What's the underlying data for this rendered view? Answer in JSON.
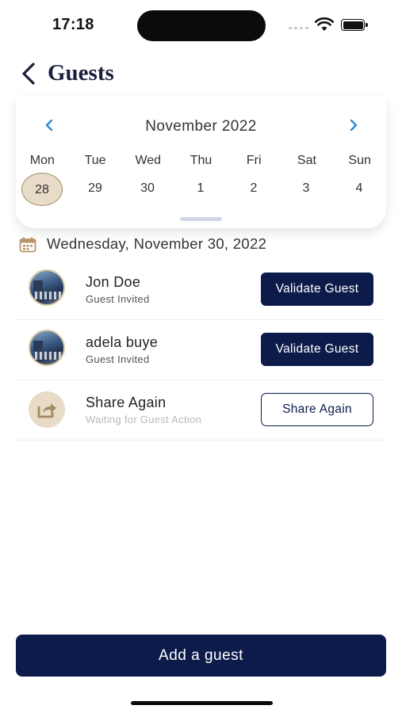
{
  "status_bar": {
    "time": "17:18"
  },
  "header": {
    "title": "Guests",
    "back_icon": "chevron-left-icon"
  },
  "calendar": {
    "month_label": "November 2022",
    "prev_icon": "chevron-left-icon",
    "next_icon": "chevron-right-icon",
    "weekdays": [
      "Mon",
      "Tue",
      "Wed",
      "Thu",
      "Fri",
      "Sat",
      "Sun"
    ],
    "days": [
      "28",
      "29",
      "30",
      "1",
      "2",
      "3",
      "4"
    ],
    "selected_day": "28",
    "selected_color": "#e8dcc8",
    "arrow_color": "#2a8bd8"
  },
  "selected_date": {
    "icon": "calendar-icon",
    "label": "Wednesday, November 30, 2022"
  },
  "guests": [
    {
      "name": "Jon Doe",
      "status": "Guest Invited",
      "action": "Validate Guest"
    },
    {
      "name": "adela buye",
      "status": "Guest Invited",
      "action": "Validate Guest"
    },
    {
      "name": "Share Again",
      "status": "Waiting for Guest Action",
      "action": "Share Again"
    }
  ],
  "footer": {
    "add_guest_label": "Add a guest"
  },
  "colors": {
    "primary": "#0c1b4a",
    "accent_gold": "#a18b60",
    "accent_beige": "#e8dcc8"
  }
}
